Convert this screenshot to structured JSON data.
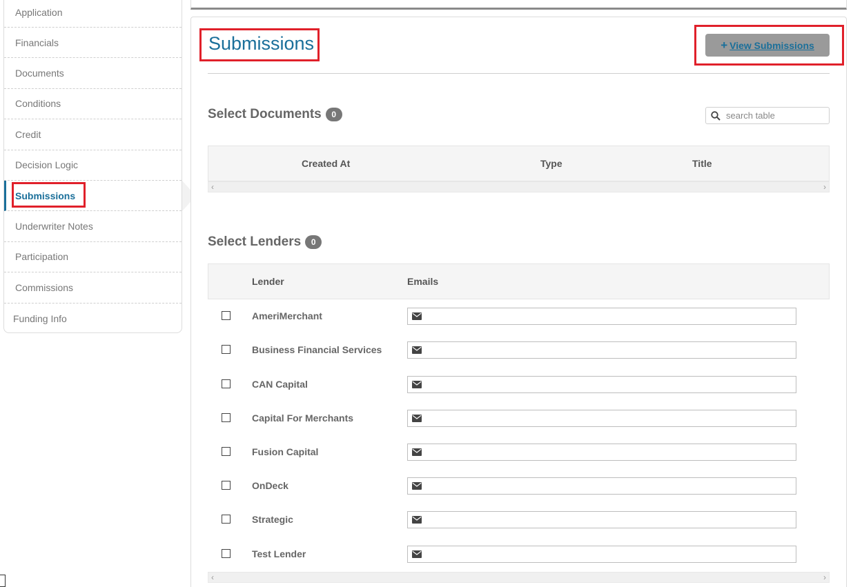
{
  "sidebar": {
    "items": [
      {
        "label": "Application"
      },
      {
        "label": "Financials"
      },
      {
        "label": "Documents"
      },
      {
        "label": "Conditions"
      },
      {
        "label": "Credit"
      },
      {
        "label": "Decision Logic"
      },
      {
        "label": "Submissions"
      },
      {
        "label": "Underwriter Notes"
      },
      {
        "label": "Participation"
      },
      {
        "label": "Commissions"
      },
      {
        "label": "Funding Info"
      }
    ],
    "active_index": 6
  },
  "header": {
    "title": "Submissions",
    "view_button_label": "View Submissions",
    "view_button_icon": "plus-icon"
  },
  "documents": {
    "title": "Select Documents",
    "count": "0",
    "search_placeholder": "search table",
    "columns": [
      "Created At",
      "Type",
      "Title"
    ]
  },
  "lenders": {
    "title": "Select Lenders",
    "count": "0",
    "columns": [
      "Lender",
      "Emails"
    ],
    "rows": [
      {
        "name": "AmeriMerchant",
        "email": ""
      },
      {
        "name": "Business Financial Services",
        "email": ""
      },
      {
        "name": "CAN Capital",
        "email": ""
      },
      {
        "name": "Capital For Merchants",
        "email": ""
      },
      {
        "name": "Fusion Capital",
        "email": ""
      },
      {
        "name": "OnDeck",
        "email": ""
      },
      {
        "name": "Strategic",
        "email": ""
      },
      {
        "name": "Test Lender",
        "email": ""
      }
    ]
  },
  "colors": {
    "accent": "#1a6f9a",
    "highlight": "#e0202a",
    "button": "#9a9a9a"
  }
}
